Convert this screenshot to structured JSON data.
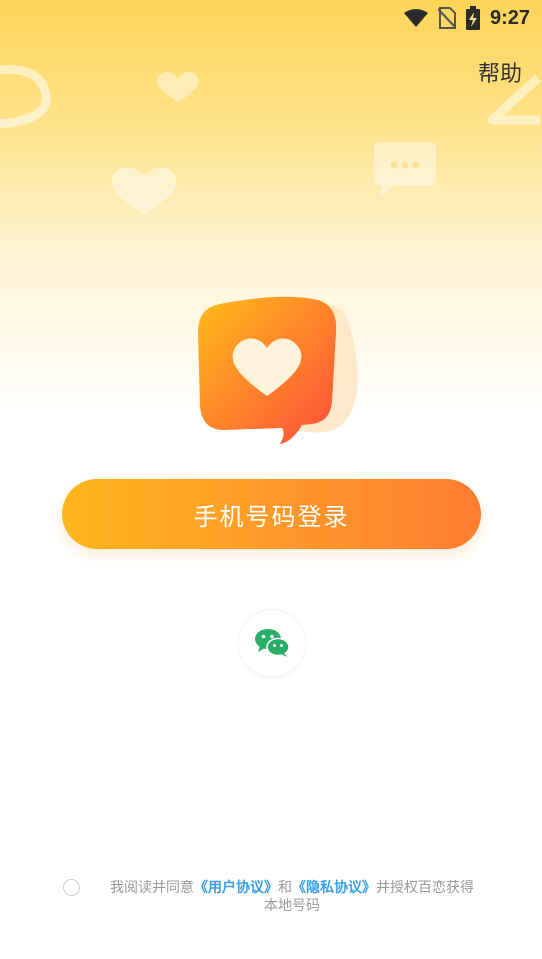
{
  "status_bar": {
    "time": "9:27",
    "icons": [
      "wifi-icon",
      "no-sim-icon",
      "battery-charging-icon"
    ]
  },
  "header": {
    "help_label": "帮助"
  },
  "logo": {
    "icon": "heart-chat-bubble-icon"
  },
  "login": {
    "phone_button_label": "手机号码登录",
    "wechat_icon": "wechat-icon"
  },
  "agreement": {
    "prefix": "我阅读并同意",
    "user_agreement": "《用户协议》",
    "and": "和",
    "privacy_agreement": "《隐私协议》",
    "suffix_line1": "并授权百恋获得",
    "suffix_line2": "本地号码"
  },
  "colors": {
    "accent_start": "#ffb61e",
    "accent_end": "#ff7c2f",
    "link": "#3aa0e8",
    "wechat_green": "#2aae67"
  }
}
